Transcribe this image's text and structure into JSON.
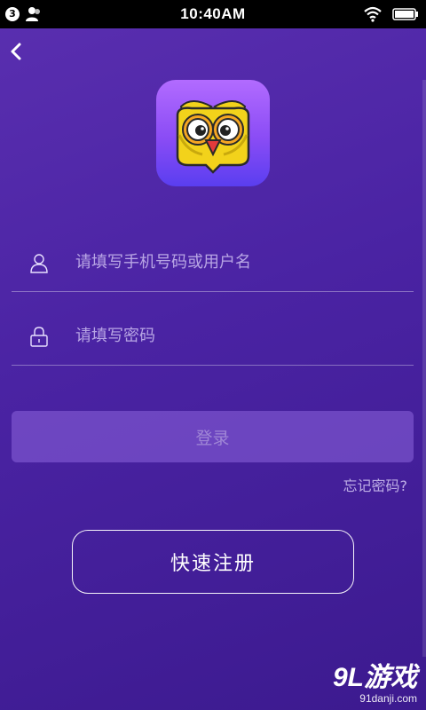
{
  "status_bar": {
    "notification_count": "3",
    "time": "10:40AM",
    "icons": [
      "user-icon",
      "wifi-icon",
      "battery-icon"
    ]
  },
  "header": {
    "back_icon": "back-arrow-icon"
  },
  "logo": {
    "icon": "owl-app-logo-icon"
  },
  "form": {
    "username": {
      "placeholder": "请填写手机号码或用户名",
      "value": "",
      "icon": "user-outline-icon"
    },
    "password": {
      "placeholder": "请填写密码",
      "value": "",
      "icon": "lock-icon"
    },
    "login_label": "登录",
    "forgot_label": "忘记密码?",
    "register_label": "快速注册"
  },
  "watermark": {
    "brand": "9L游戏",
    "url": "91danji.com"
  },
  "colors": {
    "background": "#4a23a3",
    "logo_bg": "#8a4cf5",
    "owl_yellow": "#f2d21b",
    "beak_red": "#e23b3b"
  }
}
